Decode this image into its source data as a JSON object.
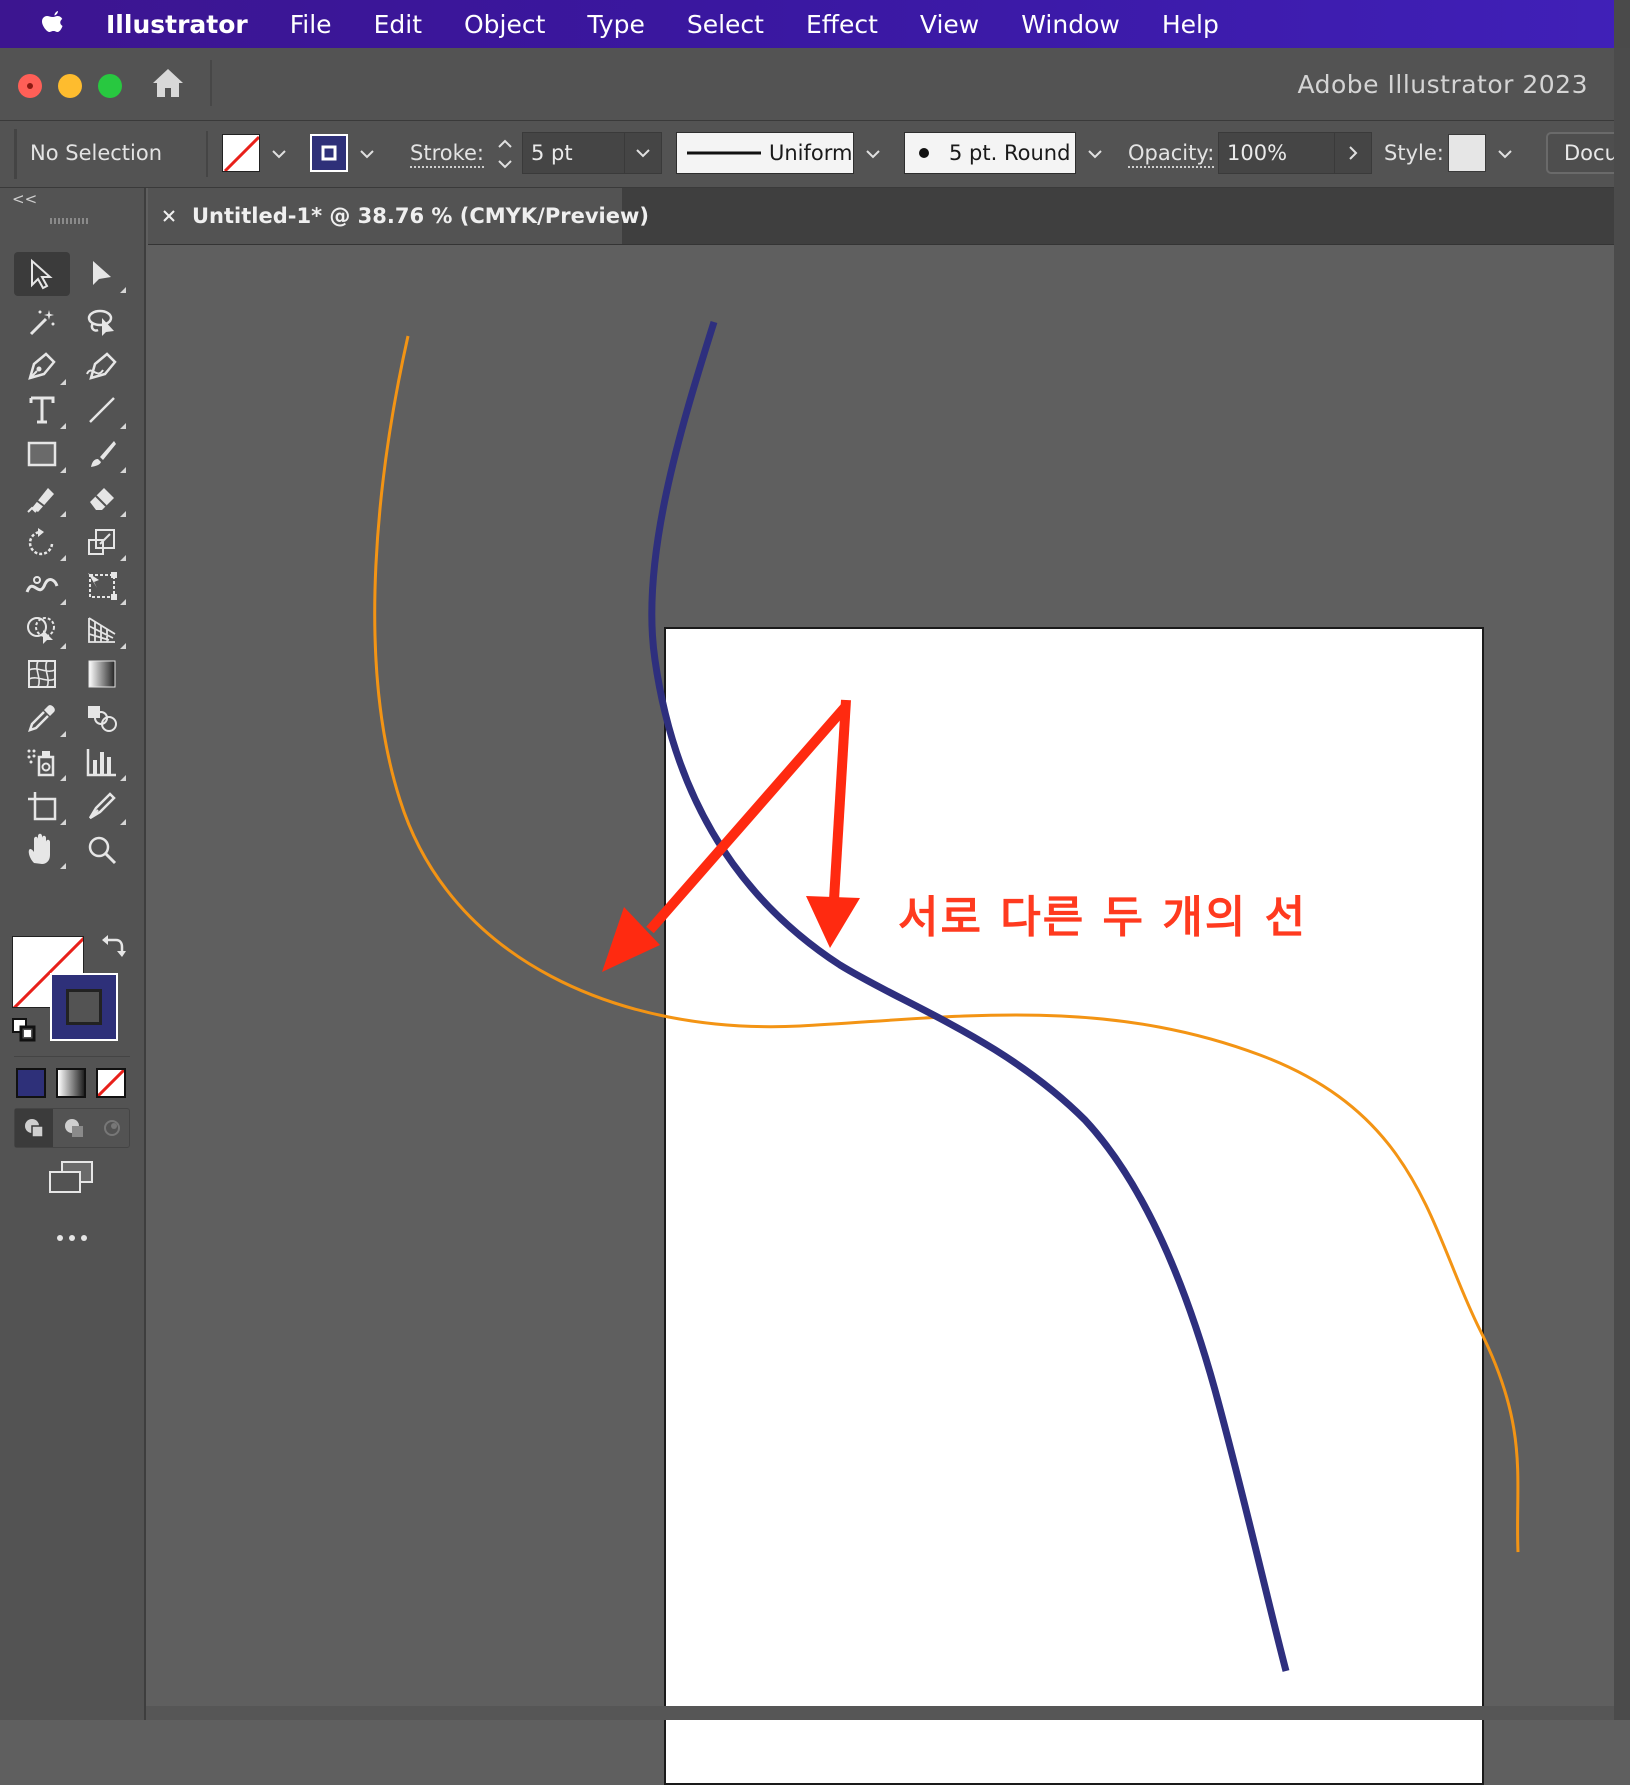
{
  "menubar": {
    "items": [
      "Illustrator",
      "File",
      "Edit",
      "Object",
      "Type",
      "Select",
      "Effect",
      "View",
      "Window",
      "Help"
    ]
  },
  "titlebar": {
    "app_title": "Adobe Illustrator 2023"
  },
  "control_bar": {
    "selection_status": "No Selection",
    "stroke_label": "Stroke:",
    "stroke_weight": "5 pt",
    "variable_width_profile": "Uniform",
    "brush": "5 pt. Round",
    "opacity_label": "Opacity:",
    "opacity_value": "100%",
    "style_label": "Style:",
    "document_setup_label": "Docum"
  },
  "document_tab": {
    "title": "Untitled-1* @ 38.76 % (CMYK/Preview)"
  },
  "toolbar": {
    "fill": "none",
    "stroke_color": "#2e3079"
  },
  "canvas": {
    "annotation": "서로 다른 두 개의 선",
    "colors": {
      "navy_path": "#2e2f7e",
      "orange_path": "#f39414",
      "arrow": "#ff2a10"
    }
  }
}
